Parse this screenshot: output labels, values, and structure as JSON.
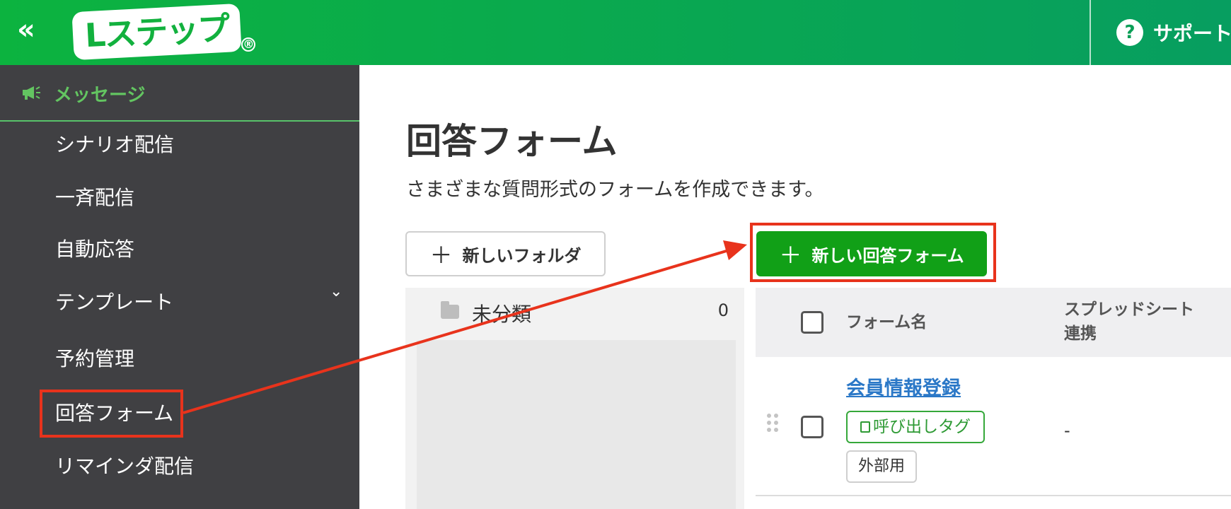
{
  "header": {
    "collapse_icon": "«",
    "logo_text": "Lステップ",
    "logo_mark": "®",
    "support_label": "サポート",
    "support_icon": "?"
  },
  "sidebar": {
    "section_label": "メッセージ",
    "items": [
      {
        "label": "シナリオ配信"
      },
      {
        "label": "一斉配信"
      },
      {
        "label": "自動応答"
      },
      {
        "label": "テンプレート"
      },
      {
        "label": "予約管理"
      },
      {
        "label": "回答フォーム"
      },
      {
        "label": "リマインダ配信"
      }
    ],
    "expand_icon": "⌄"
  },
  "main": {
    "title": "回答フォーム",
    "subtitle": "さまざまな質問形式のフォームを作成できます。",
    "new_folder_label": "新しいフォルダ",
    "new_form_label": "新しい回答フォーム",
    "plus": "＋"
  },
  "folders": [
    {
      "name": "未分類",
      "count": "0"
    }
  ],
  "table": {
    "col_name": "フォーム名",
    "col_sheet_line1": "スプレッドシート",
    "col_sheet_line2": "連携",
    "rows": [
      {
        "name": "会員情報登録",
        "tag_button": "呼び出しタグ",
        "ext_button": "外部用",
        "sheet": "-"
      }
    ]
  },
  "colors": {
    "brand_green": "#0cb33f",
    "primary_button": "#11a017",
    "highlight_red": "#e8331c",
    "sidebar_bg": "#404043",
    "link_blue": "#2b78c7"
  }
}
